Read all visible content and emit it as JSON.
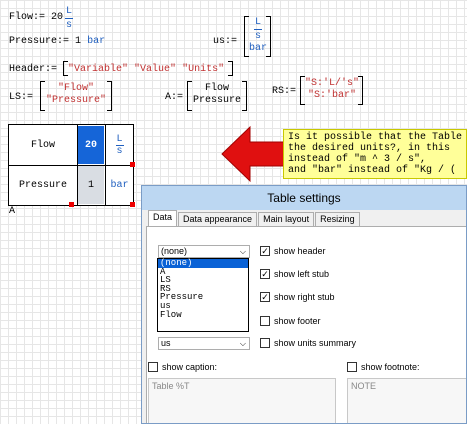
{
  "worksheet": {
    "flow_def": {
      "name": "Flow",
      "assign": ":=",
      "value": "20",
      "unit_num": "L",
      "unit_den": "s"
    },
    "pressure_def": {
      "name": "Pressure",
      "assign": ":=",
      "value": "1",
      "unit": "bar"
    },
    "us_def": {
      "name": "us",
      "assign": ":=",
      "top_num": "L",
      "top_den": "s",
      "bottom": "bar"
    },
    "header_def": {
      "name": "Header",
      "assign": ":=",
      "items": [
        "\"Variable\"",
        "\"Value\"",
        "\"Units\""
      ]
    },
    "ls_def": {
      "name": "LS",
      "assign": ":=",
      "items": [
        "\"Flow\"",
        "\"Pressure\""
      ]
    },
    "a_def": {
      "name": "A",
      "assign": ":=",
      "items": [
        "Flow",
        "Pressure"
      ]
    },
    "rs_def": {
      "name": "RS",
      "assign": ":=",
      "items": [
        "\"S:'L/'s\"",
        "\"S:'bar\""
      ]
    },
    "table": {
      "rows": [
        {
          "label": "Flow",
          "value": "20",
          "unit_num": "L",
          "unit_den": "s"
        },
        {
          "label": "Pressure",
          "value": "1",
          "unit": "bar"
        }
      ],
      "caption": "A",
      "value_highlight": "#1565d8"
    },
    "callout_lines": [
      "Is it possible that the Table",
      "the desired units?, in this",
      "instead of \"m ^ 3 / s\",",
      "and \"bar\" instead of \"Kg / ("
    ]
  },
  "dialog": {
    "title": "Table settings",
    "tabs": [
      "Data",
      "Data appearance",
      "Main layout",
      "Resizing"
    ],
    "active_tab": "Data",
    "combo_top_value": "(none)",
    "dropdown_options": [
      "(none)",
      "A",
      "LS",
      "RS",
      "Pressure",
      "us",
      "Flow"
    ],
    "dropdown_selected": "(none)",
    "combo_bottom_value": "us",
    "checks": {
      "show_header": {
        "label": "show header",
        "checked": true
      },
      "show_left_stub": {
        "label": "show left stub",
        "checked": true
      },
      "show_right_stub": {
        "label": "show right stub",
        "checked": true
      },
      "show_footer": {
        "label": "show footer",
        "checked": false
      },
      "show_units_summary": {
        "label": "show units summary",
        "checked": false
      },
      "show_caption": {
        "label": "show caption:",
        "checked": false
      },
      "show_footnote": {
        "label": "show footnote:",
        "checked": false
      }
    },
    "caption_placeholder": "Table %T",
    "footnote_placeholder": "NOTE"
  },
  "colors": {
    "accent_blue": "#1f5fbf",
    "string_red": "#c03030",
    "callout_bg": "#ffff99",
    "arrow_red": "#e01010",
    "title_bar": "#bcd7f2"
  }
}
